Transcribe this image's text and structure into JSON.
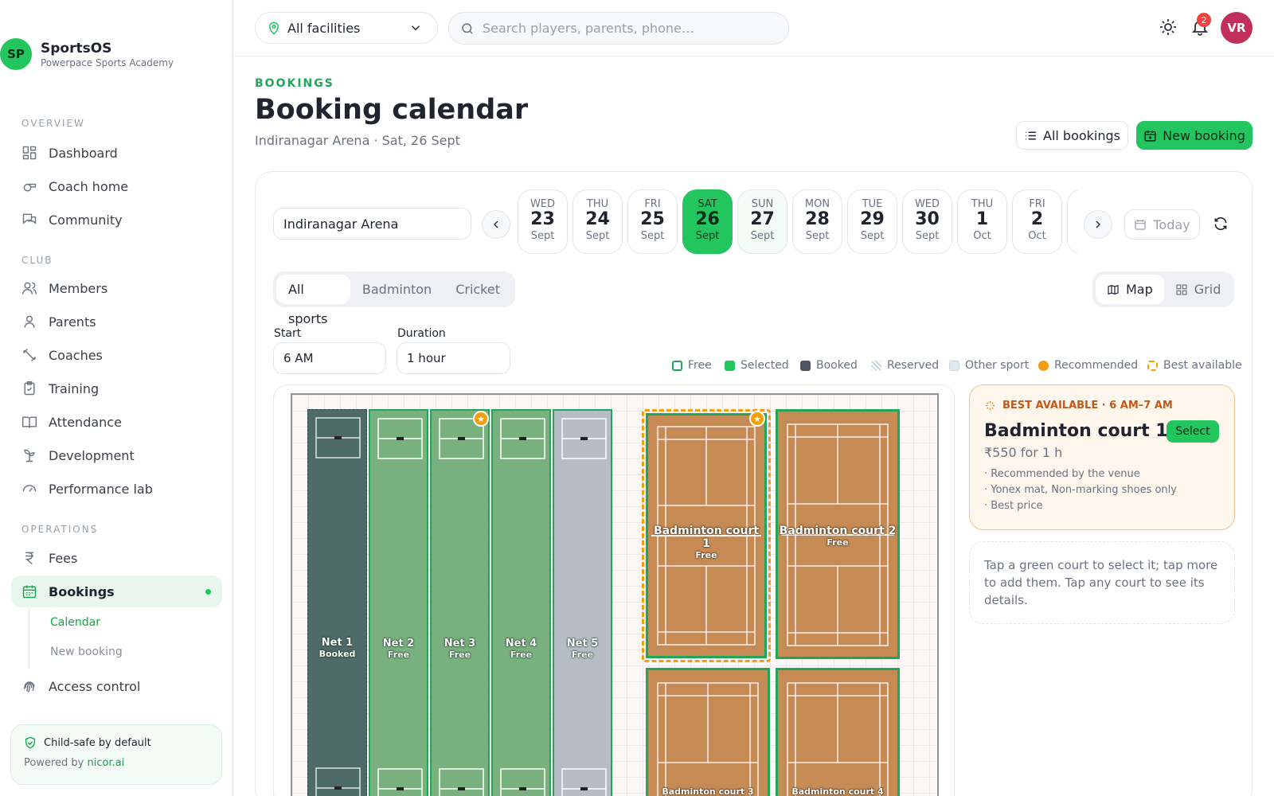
{
  "brand": {
    "initials": "SP",
    "name": "SportsOS",
    "sub": "Powerpace Sports Academy"
  },
  "sidebar": {
    "sections": [
      "OVERVIEW",
      "CLUB",
      "OPERATIONS"
    ],
    "items": [
      {
        "label": "Dashboard",
        "icon": "grid-icon"
      },
      {
        "label": "Coach home",
        "icon": "whistle-icon"
      },
      {
        "label": "Community",
        "icon": "chat-icon"
      },
      {
        "label": "Members",
        "icon": "users-icon"
      },
      {
        "label": "Parents",
        "icon": "user-icon"
      },
      {
        "label": "Coaches",
        "icon": "dumbbell-icon"
      },
      {
        "label": "Training",
        "icon": "clipboard-icon"
      },
      {
        "label": "Attendance",
        "icon": "book-icon"
      },
      {
        "label": "Development",
        "icon": "sprout-icon"
      },
      {
        "label": "Performance lab",
        "icon": "gauge-icon"
      },
      {
        "label": "Fees",
        "icon": "rupee-icon"
      },
      {
        "label": "Bookings",
        "icon": "calendar-icon"
      },
      {
        "label": "Access control",
        "icon": "fingerprint-icon"
      }
    ],
    "subitems": [
      "Calendar",
      "New booking"
    ],
    "footer": {
      "title": "Child-safe by default",
      "powered": "Powered by ",
      "link": "nicor.ai"
    }
  },
  "topbar": {
    "facility": "All facilities",
    "search_placeholder": "Search players, parents, phone…",
    "notif_count": "2",
    "avatar": "VR"
  },
  "header": {
    "eyebrow": "BOOKINGS",
    "title": "Booking calendar",
    "subtitle": "Indiranagar Arena · Sat, 26 Sept",
    "all_bookings": "All bookings",
    "new_booking": "New booking"
  },
  "calendar": {
    "venue": "Indiranagar Arena",
    "today": "Today",
    "days": [
      {
        "dow": "WED",
        "day": "23",
        "mon": "Sept"
      },
      {
        "dow": "THU",
        "day": "24",
        "mon": "Sept"
      },
      {
        "dow": "FRI",
        "day": "25",
        "mon": "Sept"
      },
      {
        "dow": "SAT",
        "day": "26",
        "mon": "Sept"
      },
      {
        "dow": "SUN",
        "day": "27",
        "mon": "Sept"
      },
      {
        "dow": "MON",
        "day": "28",
        "mon": "Sept"
      },
      {
        "dow": "TUE",
        "day": "29",
        "mon": "Sept"
      },
      {
        "dow": "WED",
        "day": "30",
        "mon": "Sept"
      },
      {
        "dow": "THU",
        "day": "1",
        "mon": "Oct"
      },
      {
        "dow": "FRI",
        "day": "2",
        "mon": "Oct"
      }
    ]
  },
  "filters": {
    "sports": [
      "All sports",
      "Badminton",
      "Cricket"
    ],
    "views": [
      "Map",
      "Grid"
    ],
    "start_label": "Start",
    "start_value": "6 AM",
    "duration_label": "Duration",
    "duration_value": "1 hour"
  },
  "legend": [
    {
      "label": "Free",
      "color": "#ffffff"
    },
    {
      "label": "Selected",
      "color": "#22c55e"
    },
    {
      "label": "Booked",
      "color": "#4b5563"
    },
    {
      "label": "Reserved",
      "color": "#cbd5e1"
    },
    {
      "label": "Other sport",
      "color": "#e2e8f0"
    },
    {
      "label": "Recommended",
      "color": "#f59e0b"
    },
    {
      "label": "Best available",
      "color": "#f59e0b"
    }
  ],
  "nets": [
    {
      "name": "Net 1",
      "status": "Booked"
    },
    {
      "name": "Net 2",
      "status": "Free"
    },
    {
      "name": "Net 3",
      "status": "Free"
    },
    {
      "name": "Net 4",
      "status": "Free"
    },
    {
      "name": "Net 5",
      "status": "Free"
    }
  ],
  "courts": [
    {
      "name": "Badminton court 1",
      "status": "Free"
    },
    {
      "name": "Badminton court 2",
      "status": "Free"
    },
    {
      "name": "Badminton court 3",
      "status": ""
    },
    {
      "name": "Badminton court 4",
      "status": ""
    }
  ],
  "best": {
    "header": "BEST AVAILABLE · 6 AM–7 AM",
    "name": "Badminton court 1",
    "price": "₹550 for 1 h",
    "select": "Select",
    "notes": [
      "· Recommended by the venue",
      "· Yonex mat, Non-marking shoes only",
      "· Best price"
    ]
  },
  "hint": "Tap a green court to select it; tap more to add them. Tap any court to see its details."
}
